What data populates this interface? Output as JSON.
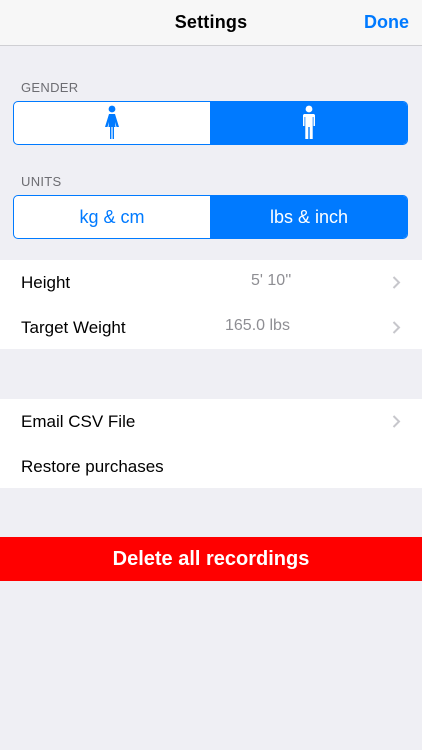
{
  "navbar": {
    "title": "Settings",
    "done_label": "Done"
  },
  "gender": {
    "header": "GENDER",
    "options": [
      {
        "icon": "female-icon",
        "selected": false
      },
      {
        "icon": "male-icon",
        "selected": true
      }
    ]
  },
  "units": {
    "header": "UNITS",
    "options": [
      {
        "label": "kg & cm",
        "selected": false
      },
      {
        "label": "lbs & inch",
        "selected": true
      }
    ]
  },
  "body_settings": {
    "rows": [
      {
        "label": "Height",
        "value": "5' 10''",
        "chevron": true
      },
      {
        "label": "Target Weight",
        "value": "165.0 lbs",
        "chevron": true
      }
    ]
  },
  "data_settings": {
    "rows": [
      {
        "label": "Email CSV File",
        "chevron": true
      },
      {
        "label": "Restore purchases",
        "chevron": false
      }
    ]
  },
  "delete": {
    "label": "Delete all recordings"
  },
  "colors": {
    "accent": "#007aff",
    "destructive": "#ff0000",
    "background": "#efeff4"
  }
}
